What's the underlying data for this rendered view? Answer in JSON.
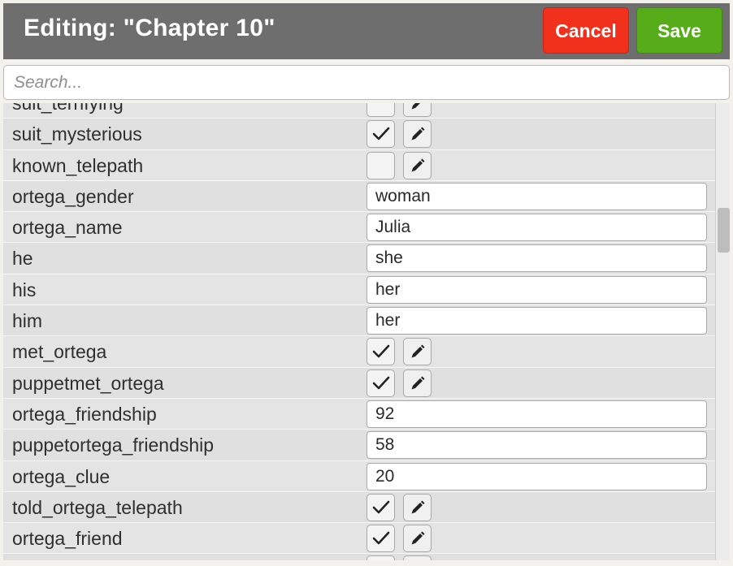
{
  "header": {
    "title": "Editing: \"Chapter 10\"",
    "cancel_label": "Cancel",
    "save_label": "Save",
    "colors": {
      "header_bg": "#6e6e6e",
      "cancel": "#f1311b",
      "save": "#56ad19"
    }
  },
  "search": {
    "placeholder": "Search...",
    "value": ""
  },
  "rows": [
    {
      "label": "suit_terrifying",
      "type": "bool",
      "checked": false
    },
    {
      "label": "suit_mysterious",
      "type": "bool",
      "checked": true
    },
    {
      "label": "known_telepath",
      "type": "bool",
      "checked": false
    },
    {
      "label": "ortega_gender",
      "type": "text",
      "value": "woman"
    },
    {
      "label": "ortega_name",
      "type": "text",
      "value": "Julia"
    },
    {
      "label": "he",
      "type": "text",
      "value": "she"
    },
    {
      "label": "his",
      "type": "text",
      "value": "her"
    },
    {
      "label": "him",
      "type": "text",
      "value": "her"
    },
    {
      "label": "met_ortega",
      "type": "bool",
      "checked": true
    },
    {
      "label": "puppetmet_ortega",
      "type": "bool",
      "checked": true
    },
    {
      "label": "ortega_friendship",
      "type": "text",
      "value": "92"
    },
    {
      "label": "puppetortega_friendship",
      "type": "text",
      "value": "58"
    },
    {
      "label": "ortega_clue",
      "type": "text",
      "value": "20"
    },
    {
      "label": "told_ortega_telepath",
      "type": "bool",
      "checked": true
    },
    {
      "label": "ortega_friend",
      "type": "bool",
      "checked": true
    },
    {
      "label": "",
      "type": "bool",
      "checked": false
    }
  ],
  "icons": {
    "check": "check-icon",
    "edit": "pencil-icon"
  }
}
